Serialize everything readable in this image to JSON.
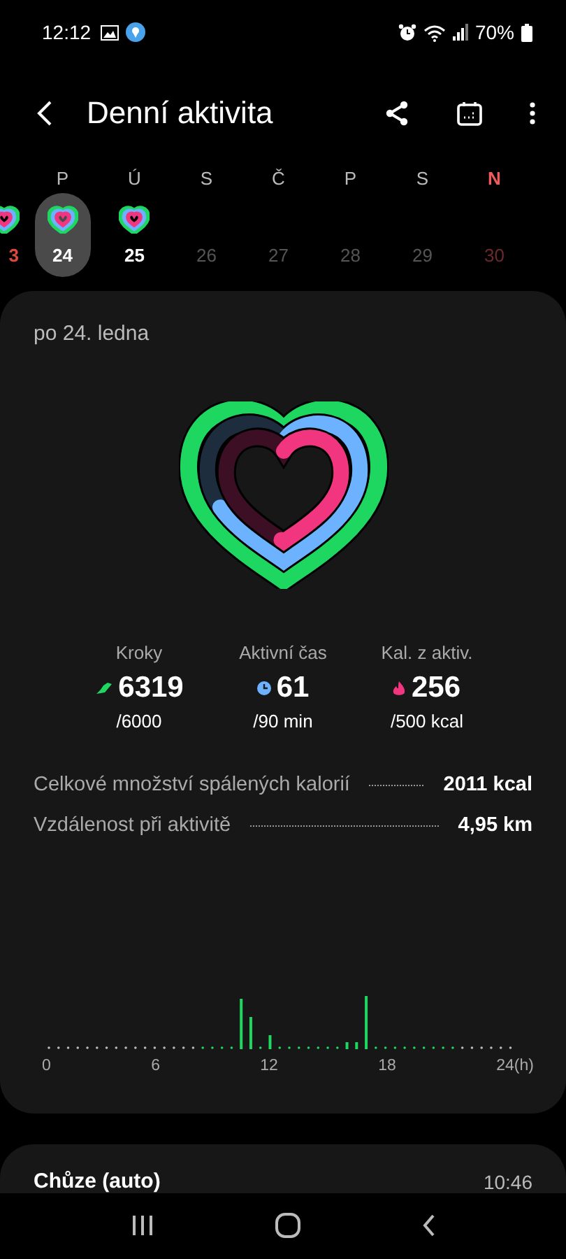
{
  "status_bar": {
    "time": "12:12",
    "battery": "70%"
  },
  "header": {
    "title": "Denní aktivita"
  },
  "week": [
    {
      "day": "3",
      "kind": "past",
      "sunday": true,
      "ring": true,
      "selected": false
    },
    {
      "weekday": "P",
      "day": "24",
      "kind": "past",
      "sunday": false,
      "ring": true,
      "selected": true
    },
    {
      "weekday": "Ú",
      "day": "25",
      "kind": "past",
      "sunday": false,
      "ring": true,
      "selected": false
    },
    {
      "weekday": "S",
      "day": "26",
      "kind": "future",
      "sunday": false,
      "ring": false,
      "selected": false
    },
    {
      "weekday": "Č",
      "day": "27",
      "kind": "future",
      "sunday": false,
      "ring": false,
      "selected": false
    },
    {
      "weekday": "P",
      "day": "28",
      "kind": "future",
      "sunday": false,
      "ring": false,
      "selected": false
    },
    {
      "weekday": "S",
      "day": "29",
      "kind": "future",
      "sunday": false,
      "ring": false,
      "selected": false
    },
    {
      "weekday": "N",
      "day": "30",
      "kind": "future",
      "sunday": true,
      "ring": false,
      "selected": false
    }
  ],
  "summary": {
    "date": "po 24. ledna",
    "stats": [
      {
        "kind": "steps",
        "label": "Kroky",
        "value": "6319",
        "goal": "/6000"
      },
      {
        "kind": "time",
        "label": "Aktivní čas",
        "value": "61",
        "goal": "/90 min"
      },
      {
        "kind": "calories",
        "label": "Kal. z aktiv.",
        "value": "256",
        "goal": "/500 kcal"
      }
    ],
    "details": [
      {
        "label": "Celkové množství spálených kalorií",
        "value": "2011 kcal"
      },
      {
        "label": "Vzdálenost při aktivitě",
        "value": "4,95 km"
      }
    ],
    "axis_labels": [
      "0",
      "6",
      "12",
      "18",
      "24(h)"
    ]
  },
  "activity": {
    "title": "Chůze (auto)",
    "time": "10:46"
  }
}
